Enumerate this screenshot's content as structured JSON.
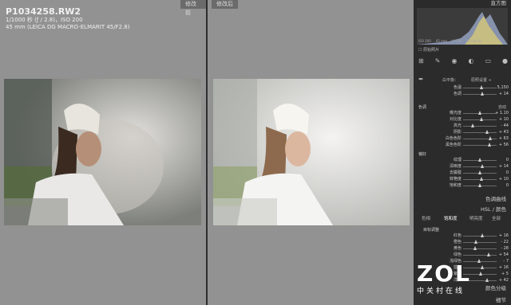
{
  "before_label": "修改前",
  "after_label": "修改后",
  "info": {
    "filename": "P1034258.RW2",
    "exposure": "1/1000 秒 (ƒ / 2.8)，ISO 200",
    "lens": "45 mm (LEICA DG MACRO-ELMARIT 45/F2.8)"
  },
  "panel": {
    "histogram_title": "直方图",
    "histo_readout": [
      "ISO 200",
      "45 mm",
      "ƒ / 2.8",
      "1/1000 秒"
    ],
    "original_photo_label": "原始照片",
    "basic": {
      "wb_label": "白平衡：",
      "wb_value": "原照设置 ÷",
      "wb_rows": [
        {
          "label": "色温",
          "value": "5,150"
        },
        {
          "label": "色调",
          "value": "+ 14"
        }
      ],
      "tone_label": "色调",
      "tone_auto": "自动",
      "tone_rows": [
        {
          "label": "曝光度",
          "value": "+ 1.10"
        },
        {
          "label": "对比度",
          "value": "+ 10"
        },
        {
          "label": "高光",
          "value": "- 44"
        },
        {
          "label": "阴影",
          "value": "+ 43"
        },
        {
          "label": "白色色阶",
          "value": "+ 63"
        },
        {
          "label": "黑色色阶",
          "value": "+ 56"
        }
      ],
      "presence_label": "偏好",
      "presence_rows": [
        {
          "label": "纹理",
          "value": "0"
        },
        {
          "label": "清晰度",
          "value": "+ 14"
        },
        {
          "label": "去朦胧",
          "value": "0"
        },
        {
          "label": "鲜艳度",
          "value": "+ 10"
        },
        {
          "label": "饱和度",
          "value": "0"
        }
      ]
    },
    "tone_curve_title": "色调曲线",
    "hsl_title": "HSL / 颜色",
    "hsl_tabs": [
      "色相",
      "饱和度",
      "明亮度",
      "全部"
    ],
    "hsl_target_label": "目标调整",
    "hsl_rows": [
      {
        "label": "红色",
        "value": "+ 16"
      },
      {
        "label": "橙色",
        "value": "- 22"
      },
      {
        "label": "黄色",
        "value": "- 28"
      },
      {
        "label": "绿色",
        "value": "+ 54"
      },
      {
        "label": "浅绿色",
        "value": "- 7"
      },
      {
        "label": "蓝色",
        "value": "+ 16"
      },
      {
        "label": "紫色",
        "value": "+ 5"
      },
      {
        "label": "洋红",
        "value": "+ 42"
      }
    ],
    "color_grading_title": "颜色分级",
    "detail_title": "细节"
  },
  "watermark": {
    "brand": "ZOL",
    "sub": "中关村在线"
  }
}
